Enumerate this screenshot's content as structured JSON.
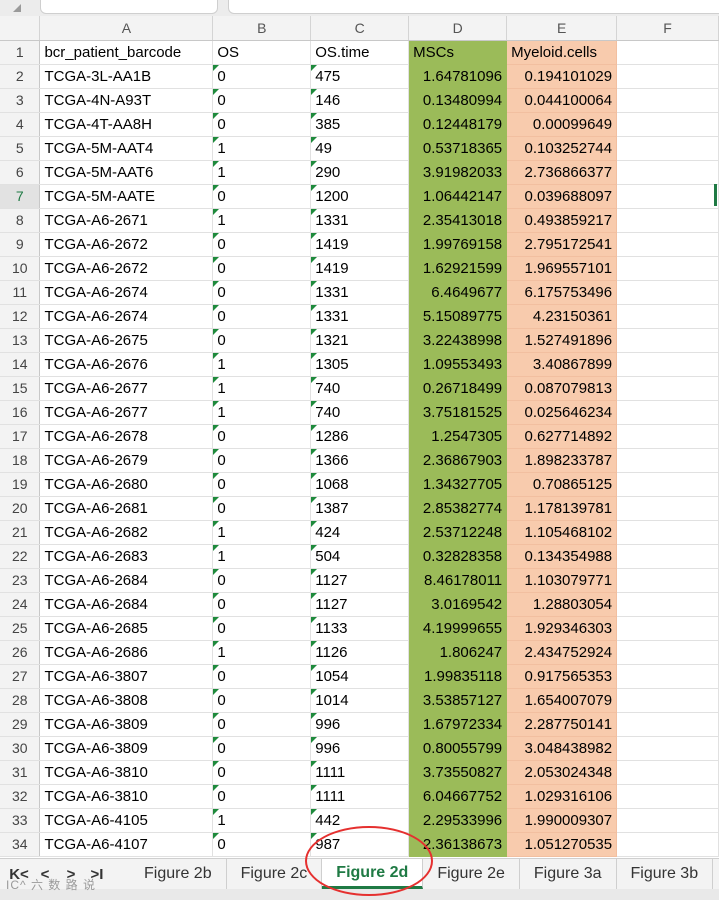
{
  "columns": [
    "A",
    "B",
    "C",
    "D",
    "E",
    "F"
  ],
  "headers": [
    "bcr_patient_barcode",
    "OS",
    "OS.time",
    "MSCs",
    "Myeloid.cells"
  ],
  "row_numbers": [
    "1",
    "2",
    "3",
    "4",
    "5",
    "6",
    "7",
    "8",
    "9",
    "10",
    "11",
    "12",
    "13",
    "14",
    "15",
    "16",
    "17",
    "18",
    "19",
    "20",
    "21",
    "22",
    "23",
    "24",
    "25",
    "26",
    "27",
    "28",
    "29",
    "30",
    "31",
    "32",
    "33",
    "34"
  ],
  "rows": [
    [
      "TCGA-3L-AA1B",
      "0",
      "475",
      "1.64781096",
      "0.194101029"
    ],
    [
      "TCGA-4N-A93T",
      "0",
      "146",
      "0.13480994",
      "0.044100064"
    ],
    [
      "TCGA-4T-AA8H",
      "0",
      "385",
      "0.12448179",
      "0.00099649"
    ],
    [
      "TCGA-5M-AAT4",
      "1",
      "49",
      "0.53718365",
      "0.103252744"
    ],
    [
      "TCGA-5M-AAT6",
      "1",
      "290",
      "3.91982033",
      "2.736866377"
    ],
    [
      "TCGA-5M-AATE",
      "0",
      "1200",
      "1.06442147",
      "0.039688097"
    ],
    [
      "TCGA-A6-2671",
      "1",
      "1331",
      "2.35413018",
      "0.493859217"
    ],
    [
      "TCGA-A6-2672",
      "0",
      "1419",
      "1.99769158",
      "2.795172541"
    ],
    [
      "TCGA-A6-2672",
      "0",
      "1419",
      "1.62921599",
      "1.969557101"
    ],
    [
      "TCGA-A6-2674",
      "0",
      "1331",
      "6.4649677",
      "6.175753496"
    ],
    [
      "TCGA-A6-2674",
      "0",
      "1331",
      "5.15089775",
      "4.23150361"
    ],
    [
      "TCGA-A6-2675",
      "0",
      "1321",
      "3.22438998",
      "1.527491896"
    ],
    [
      "TCGA-A6-2676",
      "1",
      "1305",
      "1.09553493",
      "3.40867899"
    ],
    [
      "TCGA-A6-2677",
      "1",
      "740",
      "0.26718499",
      "0.087079813"
    ],
    [
      "TCGA-A6-2677",
      "1",
      "740",
      "3.75181525",
      "0.025646234"
    ],
    [
      "TCGA-A6-2678",
      "0",
      "1286",
      "1.2547305",
      "0.627714892"
    ],
    [
      "TCGA-A6-2679",
      "0",
      "1366",
      "2.36867903",
      "1.898233787"
    ],
    [
      "TCGA-A6-2680",
      "0",
      "1068",
      "1.34327705",
      "0.70865125"
    ],
    [
      "TCGA-A6-2681",
      "0",
      "1387",
      "2.85382774",
      "1.178139781"
    ],
    [
      "TCGA-A6-2682",
      "1",
      "424",
      "2.53712248",
      "1.105468102"
    ],
    [
      "TCGA-A6-2683",
      "1",
      "504",
      "0.32828358",
      "0.134354988"
    ],
    [
      "TCGA-A6-2684",
      "0",
      "1127",
      "8.46178011",
      "1.103079771"
    ],
    [
      "TCGA-A6-2684",
      "0",
      "1127",
      "3.0169542",
      "1.28803054"
    ],
    [
      "TCGA-A6-2685",
      "0",
      "1133",
      "4.19999655",
      "1.929346303"
    ],
    [
      "TCGA-A6-2686",
      "1",
      "1126",
      "1.806247",
      "2.434752924"
    ],
    [
      "TCGA-A6-3807",
      "0",
      "1054",
      "1.99835118",
      "0.917565353"
    ],
    [
      "TCGA-A6-3808",
      "0",
      "1014",
      "3.53857127",
      "1.654007079"
    ],
    [
      "TCGA-A6-3809",
      "0",
      "996",
      "1.67972334",
      "2.287750141"
    ],
    [
      "TCGA-A6-3809",
      "0",
      "996",
      "0.80055799",
      "3.048438982"
    ],
    [
      "TCGA-A6-3810",
      "0",
      "1111",
      "3.73550827",
      "2.053024348"
    ],
    [
      "TCGA-A6-3810",
      "0",
      "1111",
      "6.04667752",
      "1.029316106"
    ],
    [
      "TCGA-A6-4105",
      "1",
      "442",
      "2.29533996",
      "1.990009307"
    ],
    [
      "TCGA-A6-4107",
      "0",
      "987",
      "2.36138673",
      "1.051270535"
    ]
  ],
  "sheet_tabs": [
    "Figure 2b",
    "Figure 2c",
    "Figure 2d",
    "Figure 2e",
    "Figure 3a",
    "Figure 3b"
  ],
  "active_tab": "Figure 2d",
  "nav_buttons": [
    "K<",
    "<",
    ">",
    ">I"
  ],
  "watermark": "IC^ 六 数 路 说",
  "colors": {
    "msc_fill": "#9bbb59",
    "myeloid_fill": "#f8cbad",
    "active_tab_text": "#1f7a44",
    "annotation_circle": "#e5302f"
  }
}
